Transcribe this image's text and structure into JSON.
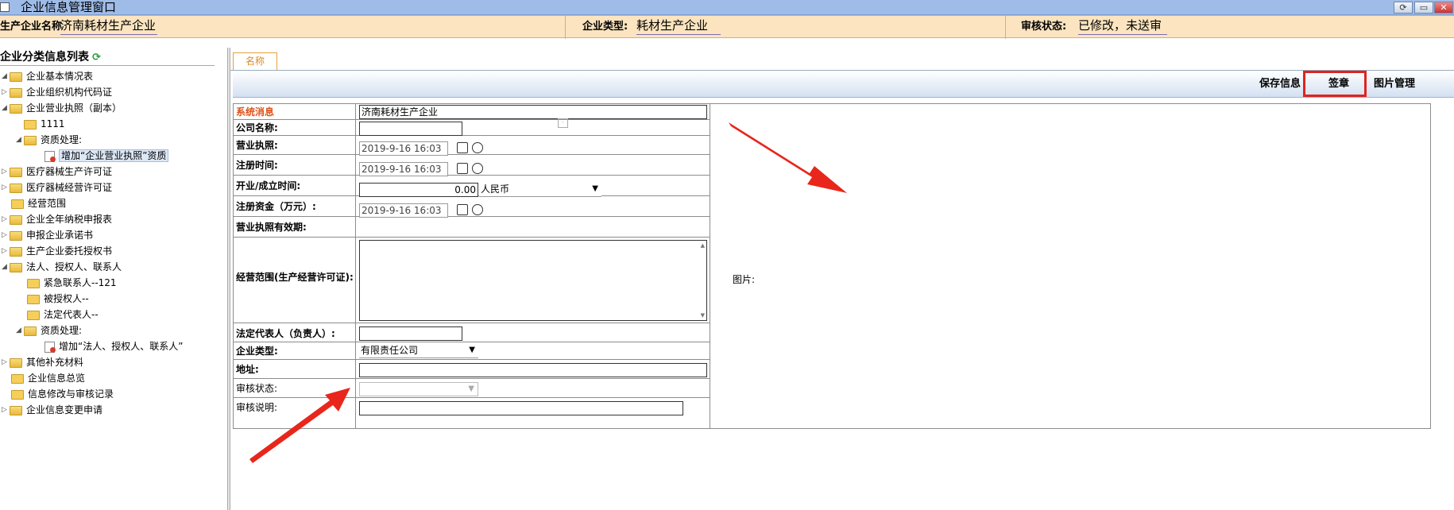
{
  "window": {
    "title": "企业信息管理窗口"
  },
  "infobar": {
    "company_label": "生产企业名称",
    "company_value": "济南耗材生产企业",
    "type_label": "企业类型:",
    "type_value": "耗材生产企业",
    "status_label": "审核状态:",
    "status_value": "已修改，未送审"
  },
  "sidebar": {
    "title": "企业分类信息列表",
    "items": [
      {
        "label": "企业基本情况表"
      },
      {
        "label": "企业组织机构代码证"
      },
      {
        "label": "企业营业执照（副本）"
      },
      {
        "label": "1111"
      },
      {
        "label": "资质处理:"
      },
      {
        "label": "增加“企业营业执照”资质"
      },
      {
        "label": "医疗器械生产许可证"
      },
      {
        "label": "医疗器械经营许可证"
      },
      {
        "label": "经营范围"
      },
      {
        "label": "企业全年纳税申报表"
      },
      {
        "label": "申报企业承诺书"
      },
      {
        "label": "生产企业委托授权书"
      },
      {
        "label": "法人、授权人、联系人"
      },
      {
        "label": "紧急联系人--121"
      },
      {
        "label": "被授权人--"
      },
      {
        "label": "法定代表人--"
      },
      {
        "label": "资质处理:"
      },
      {
        "label": "增加“法人、授权人、联系人”"
      },
      {
        "label": "其他补充材料"
      },
      {
        "label": "企业信息总览"
      },
      {
        "label": "信息修改与审核记录"
      },
      {
        "label": "企业信息变更申请"
      }
    ]
  },
  "tab": {
    "label": "名称"
  },
  "toolbar": {
    "save": "保存信息",
    "seal": "签章",
    "images": "图片管理"
  },
  "form": {
    "system_message": "系统消息",
    "company_name_label": "公司名称:",
    "company_name_value": "济南耗材生产企业",
    "license_label": "营业执照:",
    "license_value": "",
    "reg_time_label": "注册时间:",
    "reg_time_value": "2019-9-16 16:03",
    "open_time_label": "开业/成立时间:",
    "open_time_value": "2019-9-16 16:03",
    "capital_label": "注册资金（万元）:",
    "capital_value": "0.00",
    "currency_value": "人民币",
    "license_valid_label": "营业执照有效期:",
    "license_valid_value": "2019-9-16 16:03",
    "scope_label": "经营范围(生产经营许可证):",
    "picture_label": "图片:",
    "legal_rep_label": "法定代表人（负责人）:",
    "legal_rep_value": "",
    "company_type_label": "企业类型:",
    "company_type_value": "有限责任公司",
    "address_label": "地址:",
    "address_value": "",
    "review_status_label": "审核状态:",
    "review_status_value": "",
    "review_note_label": "审核说明:",
    "review_note_value": ""
  },
  "colors": {
    "annotation_red": "#e8261b",
    "infobar_bg": "#fbe4bf",
    "titlebar_bg": "#9fbce8",
    "message_red": "#e0531a"
  }
}
